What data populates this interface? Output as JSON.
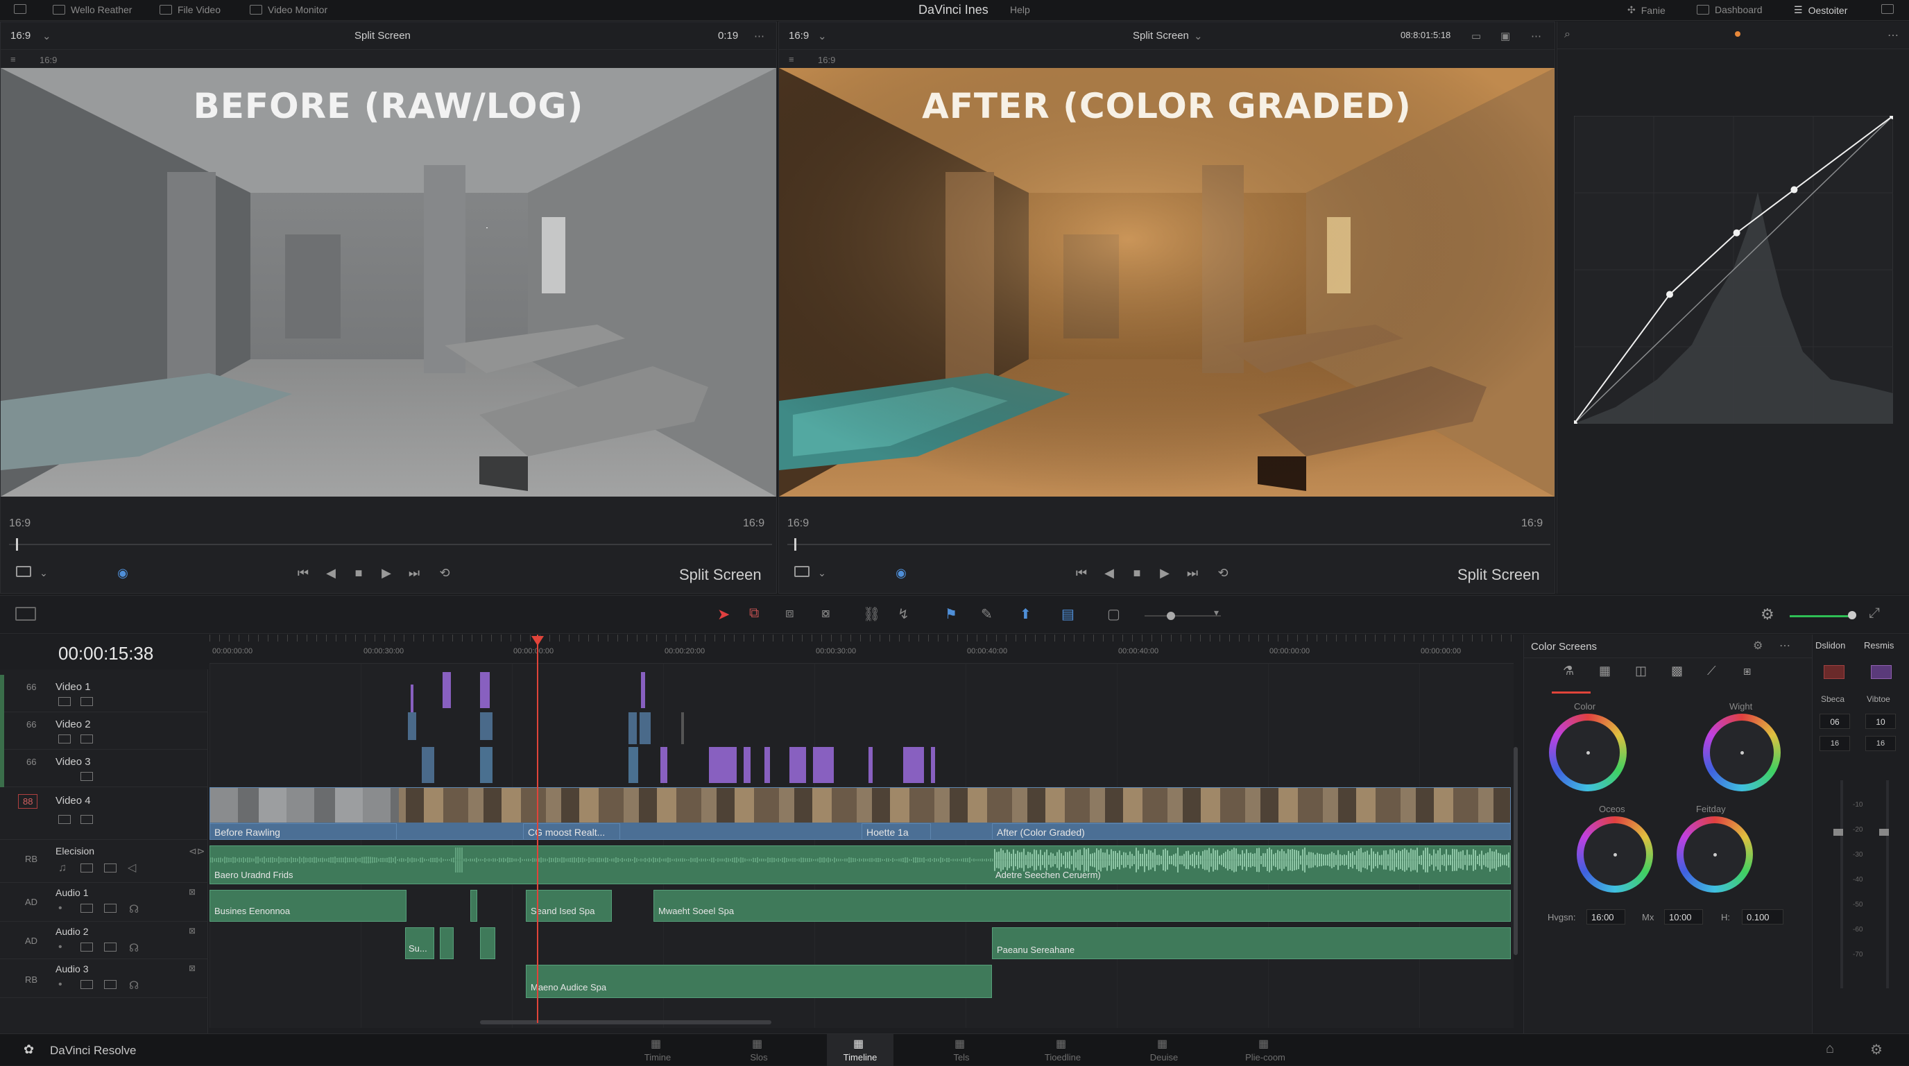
{
  "menubar": {
    "left_items": [
      "Wello Reather",
      "File Video",
      "Video Monitor"
    ],
    "title": "DaVinci Ines",
    "help": "Help",
    "right_items": [
      "Fanie",
      "Dashboard",
      "Oestoiter"
    ]
  },
  "viewer_left": {
    "aspect": "16:9",
    "mode": "Split Screen",
    "timecode": "0:19",
    "sub_aspect": "16:9",
    "overlay": "BEFORE (RAW/LOG)",
    "time_left": "16:9",
    "time_right": "16:9",
    "footer_mode": "Split Screen"
  },
  "viewer_right": {
    "aspect": "16:9",
    "mode": "Split Screen",
    "timecode": "08:8:01:5:18",
    "sub_aspect": "16:9",
    "overlay": "AFTER (COLOR GRADED)",
    "time_left": "16:9",
    "time_right": "16:9",
    "footer_mode": "Split Screen"
  },
  "curves": {
    "points": [
      [
        0,
        0
      ],
      [
        0.3,
        0.42
      ],
      [
        0.51,
        0.62
      ],
      [
        0.69,
        0.76
      ],
      [
        1,
        1
      ]
    ]
  },
  "timeline": {
    "timecode": "00:00:15:38",
    "ruler": [
      "00:00:00:00",
      "00:00:30:00",
      "00:00:00:00",
      "00:00:20:00",
      "00:00:30:00",
      "00:00:40:00",
      "00:00:40:00",
      "00:00:00:00",
      "00:00:00:00"
    ],
    "tracks": [
      {
        "num": "66",
        "name": "Video 1"
      },
      {
        "num": "66",
        "name": "Video 2"
      },
      {
        "num": "66",
        "name": "Video 3"
      },
      {
        "num": "88",
        "name": "Video 4"
      },
      {
        "num": "RB",
        "name": "Elecision"
      },
      {
        "num": "AD",
        "name": "Audio 1"
      },
      {
        "num": "AD",
        "name": "Audio 2"
      },
      {
        "num": "RB",
        "name": "Audio 3"
      }
    ],
    "clips_video4": [
      "Before Rawling",
      "CG moost Realt...",
      "Hoette 1a",
      "After (Color Graded)"
    ],
    "clips_audio": {
      "elecision": [
        "Baero Uradnd Frids",
        "Adetre Seechen Ceruerm)"
      ],
      "audio1": [
        "Busines Eenonnoa",
        "Seand Ised Spa",
        "Mwaeht Soeel Spa"
      ],
      "audio2": [
        "Su...",
        "Paeanu Sereahane"
      ],
      "audio3": [
        "Maeno Audice Spa"
      ]
    }
  },
  "color_panel": {
    "title": "Color Screens",
    "wheels": [
      "Color",
      "Wight",
      "Oceos",
      "Feitday"
    ],
    "params": [
      {
        "label": "Hvgsn:",
        "value": "16:00"
      },
      {
        "label": "Mx",
        "value": "10:00"
      },
      {
        "label": "H:",
        "value": "0.100"
      }
    ]
  },
  "side_panel": {
    "tabs": [
      "Dslidon",
      "Resmis"
    ],
    "labels": [
      "Sbeca",
      "Vibtoe"
    ],
    "values": [
      "06",
      "10",
      "16",
      "16"
    ],
    "scale": [
      "-10",
      "-20",
      "-30",
      "-40",
      "-50",
      "-60",
      "-70"
    ]
  },
  "bottom_bar": {
    "app": "DaVinci Resolve",
    "tabs": [
      "Timine",
      "Slos",
      "Timeline",
      "Tels",
      "Tioedline",
      "Deuise",
      "Plie-coom"
    ],
    "active": "Timeline"
  }
}
